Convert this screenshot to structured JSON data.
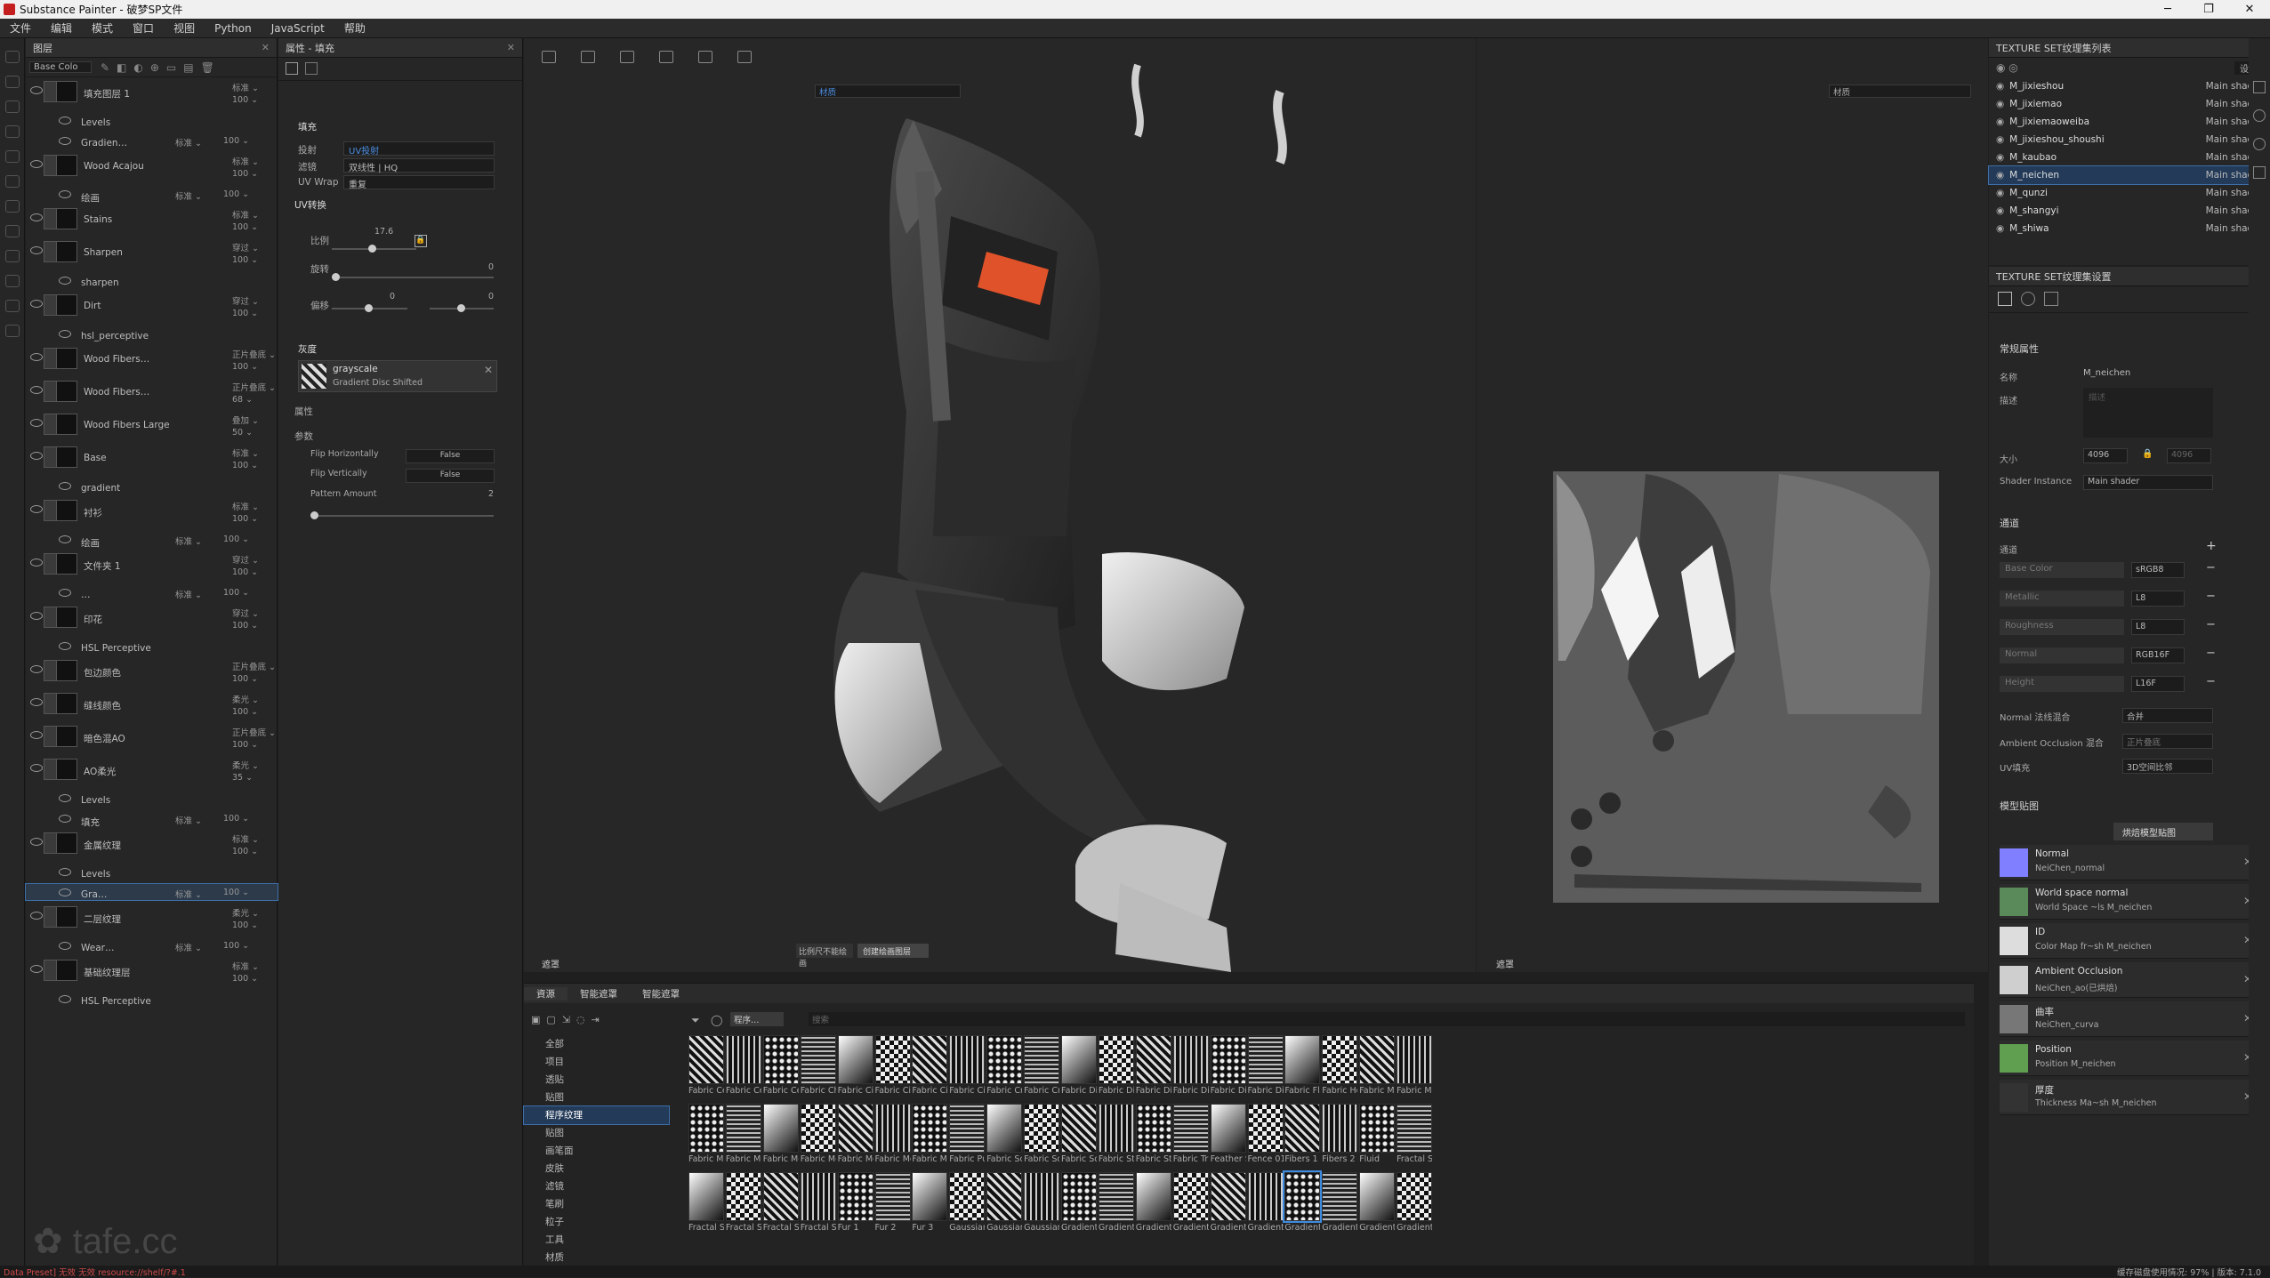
{
  "window": {
    "title": "Substance Painter - 破梦SP文件"
  },
  "menu": [
    "文件",
    "编辑",
    "模式",
    "窗口",
    "视图",
    "Python",
    "JavaScript",
    "帮助"
  ],
  "layers_panel": {
    "title": "图层",
    "channel": "Base Colo",
    "rows": [
      {
        "name": "填充图层 1",
        "blend": "标准",
        "opacity": "100"
      },
      {
        "name": "Levels",
        "sub": true
      },
      {
        "name": "Gradien…",
        "sub": true,
        "blend": "标准",
        "opacity": "100"
      },
      {
        "name": "Wood Acajou",
        "blend": "标准",
        "opacity": "100"
      },
      {
        "name": "绘画",
        "sub": true,
        "blend": "标准",
        "opacity": "100"
      },
      {
        "name": "Stains",
        "blend": "标准",
        "opacity": "100"
      },
      {
        "name": "Sharpen",
        "blend": "穿过",
        "opacity": "100"
      },
      {
        "name": "sharpen",
        "sub": true
      },
      {
        "name": "Dirt",
        "blend": "穿过",
        "opacity": "100"
      },
      {
        "name": "hsl_perceptive",
        "sub": true
      },
      {
        "name": "Wood Fibers…",
        "blend": "正片叠底",
        "opacity": "100"
      },
      {
        "name": "Wood Fibers…",
        "blend": "正片叠底",
        "opacity": "68"
      },
      {
        "name": "Wood Fibers Large",
        "blend": "叠加",
        "opacity": "50"
      },
      {
        "name": "Base",
        "blend": "标准",
        "opacity": "100"
      },
      {
        "name": "gradient",
        "sub": true
      },
      {
        "name": "衬衫",
        "blend": "标准",
        "opacity": "100"
      },
      {
        "name": "绘画",
        "sub": true,
        "blend": "标准",
        "opacity": "100"
      },
      {
        "name": "文件夹 1",
        "blend": "穿过",
        "opacity": "100"
      },
      {
        "name": "…",
        "sub": true,
        "blend": "标准",
        "opacity": "100"
      },
      {
        "name": "印花",
        "blend": "穿过",
        "opacity": "100"
      },
      {
        "name": "HSL Perceptive",
        "sub": true
      },
      {
        "name": "包边颜色",
        "blend": "正片叠底",
        "opacity": "100"
      },
      {
        "name": "缝线颜色",
        "blend": "柔光",
        "opacity": "100"
      },
      {
        "name": "暗色混AO",
        "blend": "正片叠底",
        "opacity": "100"
      },
      {
        "name": "AO柔光",
        "blend": "柔光",
        "opacity": "35"
      },
      {
        "name": "Levels",
        "sub": true
      },
      {
        "name": "填充",
        "sub": true,
        "blend": "标准",
        "opacity": "100"
      },
      {
        "name": "金属纹理",
        "blend": "标准",
        "opacity": "100"
      },
      {
        "name": "Levels",
        "sub": true
      },
      {
        "name": "Gra…",
        "sub": true,
        "blend": "标准",
        "opacity": "100",
        "selected": true
      },
      {
        "name": "二层纹理",
        "blend": "柔光",
        "opacity": "100"
      },
      {
        "name": "Wear…",
        "sub": true,
        "blend": "标准",
        "opacity": "100"
      },
      {
        "name": "基础纹理层",
        "blend": "标准",
        "opacity": "100"
      },
      {
        "name": "HSL Perceptive",
        "sub": true
      }
    ]
  },
  "properties": {
    "title": "属性 - 填充",
    "section_fill": "填充",
    "projection_label": "投射",
    "projection_value": "UV投射",
    "filter_label": "滤镜",
    "filter_value": "双线性 | HQ",
    "uvwrap_label": "UV Wrap",
    "uvwrap_value": "重复",
    "uv_transform": "UV转换",
    "scale_label": "比例",
    "scale_value": "17.6",
    "rotation_label": "旋转",
    "rotation_value": "0",
    "offset_label": "偏移",
    "offset_x": "0",
    "offset_y": "0",
    "grayscale_section": "灰度",
    "grayscale_name": "grayscale",
    "grayscale_resource": "Gradient Disc Shifted",
    "attributes": "属性",
    "params": "参数",
    "flip_h_label": "Flip Horizontally",
    "flip_h_value": "False",
    "flip_v_label": "Flip Vertically",
    "flip_v_value": "False",
    "pattern_label": "Pattern Amount",
    "pattern_value": "2"
  },
  "viewport": {
    "material_dropdown": "材质",
    "uv_material_dropdown": "材质",
    "mask_label": "遮罩",
    "mask_label_uv": "遮罩",
    "bake_btn": "比例尺不能绘画",
    "create_btn": "创建绘画图层"
  },
  "shelf": {
    "tabs": [
      "資源",
      "智能遮罩",
      "智能遮罩"
    ],
    "filter_chip": "程序…",
    "search_placeholder": "搜索",
    "categories": [
      "全部",
      "项目",
      "透贴",
      "贴图",
      "程序纹理",
      "贴图",
      "画笔面",
      "皮肤",
      "滤镜",
      "笔刷",
      "粒子",
      "工具",
      "材质"
    ],
    "selected_category": "程序纹理",
    "tiles": [
      "Fabric Cel…",
      "Fabric Cel…",
      "Fabric Cel…",
      "Fabric Che…",
      "Fabric Circ…",
      "Fabric Circ…",
      "Fabric Circ…",
      "Fabric Circ…",
      "Fabric Cro…",
      "Fabric Cro…",
      "Fabric Dia…",
      "Fabric Dia…",
      "Fabric Dia…",
      "Fabric Dia…",
      "Fabric Dia…",
      "Fabric Dia…",
      "Fabric Fle…",
      "Fabric Ho…",
      "Fabric Me…",
      "Fabric Me…",
      "Fabric Me…",
      "Fabric Me…",
      "Fabric Me…",
      "Fabric Me…",
      "Fabric Me…",
      "Fabric Me…",
      "Fabric Me…",
      "Fabric Puff…",
      "Fabric Squ…",
      "Fabric Squ…",
      "Fabric Squ…",
      "Fabric Sta…",
      "Fabric Sta…",
      "Fabric Tria…",
      "Feather St…",
      "Fence 01",
      "Fibers 1",
      "Fibers 2",
      "Fluid",
      "Fractal Su…",
      "Fractal Su…",
      "Fractal Su…",
      "Fractal Su…",
      "Fractal Su…",
      "Fur 1",
      "Fur 2",
      "Fur 3",
      "Gaussian …",
      "Gaussian …",
      "Gaussian …",
      "Gradient …",
      "Gradient B…",
      "Gradient …",
      "Gradient …",
      "Gradient …",
      "Gradient …",
      "Gradient …",
      "Gradient …",
      "Gradient F…",
      "Gradient …"
    ],
    "selected_tile": 56
  },
  "texture_sets": {
    "title": "TEXTURE SET纹理集列表",
    "settings": "设置",
    "items": [
      {
        "name": "M_jixieshou",
        "shader": "Main shader"
      },
      {
        "name": "M_jixiemao",
        "shader": "Main shader"
      },
      {
        "name": "M_jixiemaoweiba",
        "shader": "Main shader"
      },
      {
        "name": "M_jixieshou_shoushi",
        "shader": "Main shader"
      },
      {
        "name": "M_kaubao",
        "shader": "Main shader"
      },
      {
        "name": "M_neichen",
        "shader": "Main shader",
        "selected": true
      },
      {
        "name": "M_qunzi",
        "shader": "Main shader"
      },
      {
        "name": "M_shangyi",
        "shader": "Main shader"
      },
      {
        "name": "M_shiwa",
        "shader": "Main shader"
      }
    ]
  },
  "ts_settings": {
    "title": "TEXTURE SET纹理集设置",
    "general": "常规属性",
    "name_label": "名称",
    "name_value": "M_neichen",
    "desc_label": "描述",
    "desc_placeholder": "描述",
    "size_label": "大小",
    "size_value": "4096",
    "size_value2": "4096",
    "shader_label": "Shader Instance",
    "shader_value": "Main shader",
    "channels_section": "通道",
    "channels_label": "通道",
    "channels": [
      {
        "name": "Base Color",
        "format": "sRGB8"
      },
      {
        "name": "Metallic",
        "format": "L8"
      },
      {
        "name": "Roughness",
        "format": "L8"
      },
      {
        "name": "Normal",
        "format": "RGB16F"
      },
      {
        "name": "Height",
        "format": "L16F"
      }
    ],
    "normal_mix_label": "Normal 法线混合",
    "normal_mix_value": "合并",
    "ao_mix_label": "Ambient Occlusion 混合",
    "ao_mix_value": "正片叠底",
    "uv_pad_label": "UV填充",
    "uv_pad_value": "3D空间比邻",
    "mesh_maps": "模型贴图",
    "bake_btn": "烘焙模型贴图",
    "maps": [
      {
        "name": "Normal",
        "value": "NeiChen_normal",
        "color": "#7f7fff"
      },
      {
        "name": "World space normal",
        "value": "World Space ~ls M_neichen",
        "color": "#5a8a5a"
      },
      {
        "name": "ID",
        "value": "Color Map fr~sh M_neichen",
        "color": "#dddddd"
      },
      {
        "name": "Ambient Occlusion",
        "value": "NeiChen_ao(已烘焙)",
        "color": "#cfcfcf"
      },
      {
        "name": "曲率",
        "value": "NeiChen_curva",
        "color": "#777777"
      },
      {
        "name": "Position",
        "value": "Position M_neichen",
        "color": "#5f9f4f"
      },
      {
        "name": "厚度",
        "value": "Thickness Ma~sh M_neichen",
        "color": "#333333"
      }
    ]
  },
  "statusbar": {
    "left": "Data Preset] 无效 无效 resource://shelf/?#.1",
    "right": "缓存磁盘使用情况: 97% | 版本: 7.1.0"
  }
}
